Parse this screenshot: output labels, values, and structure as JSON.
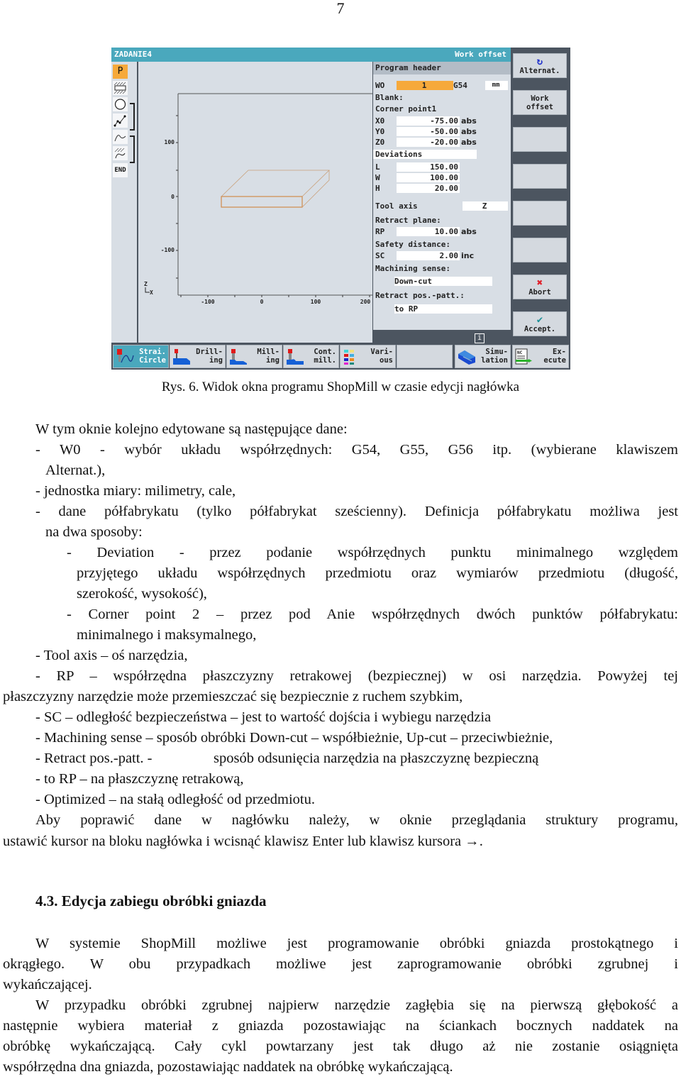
{
  "page_number": "7",
  "screen": {
    "title": "ZADANIE4",
    "mode": "Work offset",
    "left_strip": [
      "P",
      "blank-rect-icon",
      "circle-pocket-icon",
      "contour-points-icon",
      "contour-curve-icon",
      "contour-mill-icon",
      "END"
    ],
    "graph": {
      "y_ticks": [
        "100",
        "0",
        "-100"
      ],
      "x_ticks": [
        "-100",
        "0",
        "100",
        "200"
      ],
      "axis_z": "Z",
      "axis_x": "X"
    },
    "form": {
      "header": "Program header",
      "w0_label": "WO",
      "w0_value": "1",
      "w0_g": "G54",
      "unit": "mm",
      "blank_label": "Blank:",
      "corner_label": "Corner point1",
      "x0_label": "X0",
      "x0_value": "-75.00",
      "x0_unit": "abs",
      "y0_label": "Y0",
      "y0_value": "-50.00",
      "y0_unit": "abs",
      "z0_label": "Z0",
      "z0_value": "-20.00",
      "z0_unit": "abs",
      "deviations_label": "Deviations",
      "l_label": "L",
      "l_value": "150.00",
      "w_label": "W",
      "w_value": "100.00",
      "h_label": "H",
      "h_value": "20.00",
      "tool_axis_label": "Tool axis",
      "tool_axis_value": "Z",
      "retract_plane_label": "Retract plane:",
      "rp_label": "RP",
      "rp_value": "10.00",
      "rp_unit": "abs",
      "safety_label": "Safety distance:",
      "sc_label": "SC",
      "sc_value": "2.00",
      "sc_unit": "inc",
      "machining_label": "Machining sense:",
      "machining_value": "Down-cut",
      "retract_patt_label": "Retract pos.-patt.:",
      "retract_patt_value": "to RP"
    },
    "vertical_softkeys": [
      {
        "line1": "Alternat.",
        "line2": ""
      },
      {
        "line1": "Work",
        "line2": "offset"
      },
      {
        "line1": "",
        "line2": ""
      },
      {
        "line1": "",
        "line2": ""
      },
      {
        "line1": "",
        "line2": ""
      },
      {
        "line1": "",
        "line2": ""
      },
      {
        "line1": "Abort",
        "line2": ""
      },
      {
        "line1": "Accept.",
        "line2": ""
      }
    ],
    "horizontal_softkeys": [
      {
        "line1": "Strai.",
        "line2": "Circle"
      },
      {
        "line1": "Drill-",
        "line2": "ing"
      },
      {
        "line1": "Mill-",
        "line2": "ing"
      },
      {
        "line1": "Cont.",
        "line2": "mill."
      },
      {
        "line1": "Vari-",
        "line2": "ous"
      },
      {
        "line1": "",
        "line2": ""
      },
      {
        "line1": "Simu-",
        "line2": "lation"
      },
      {
        "line1": "Ex-",
        "line2": "ecute"
      }
    ],
    "info_glyph": "i"
  },
  "caption": "Rys. 6. Widok okna programu ShopMill w czasie edycji nagłówka",
  "body": {
    "intro": "W tym oknie kolejno edytowane są następujące dane:",
    "w0_line1": "- W0 - wybór układu współrzędnych: G54, G55, G56 itp. (wybierane klawiszem",
    "w0_line2": "Alternat.),",
    "unit_line": "- jednostka miary: milimetry, cale,",
    "blank_line1": "- dane półfabrykatu (tylko półfabrykat sześcienny). Definicja półfabrykatu możliwa jest",
    "blank_line2": "na dwa sposoby:",
    "dev_line1": "- Deviation - przez podanie współrzędnych punktu minimalnego względem",
    "dev_line2": "przyjętego układu współrzędnych przedmiotu oraz wymiarów przedmiotu (długość,",
    "dev_line3": "szerokość, wysokość),",
    "corner_line1": "- Corner point 2 – przez pod Anie współrzędnych dwóch punktów półfabrykatu:",
    "corner_line2": "minimalnego i maksymalnego,",
    "tool_line": "- Tool axis – oś narzędzia,",
    "rp_line1": "- RP – współrzędna płaszczyzny retrakowej (bezpiecznej) w osi narzędzia. Powyżej tej",
    "rp_line2": "płaszczyzny narzędzie może przemieszczać się bezpiecznie z ruchem szybkim,",
    "sc_line": "- SC – odległość bezpieczeństwa – jest to wartość dojścia i wybiegu narzędzia",
    "mach_line": "- Machining sense – sposób obróbki Down-cut – współbieżnie, Up-cut – przeciwbieżnie,",
    "retract_line_a": "- Retract pos.-patt. -",
    "retract_line_b": "sposób odsunięcia narzędzia na płaszczyznę bezpieczną",
    "torp_line": "- to RP – na płaszczyznę retrakową,",
    "opt_line": "- Optimized – na stałą odległość od przedmiotu.",
    "fix_line1": "Aby poprawić dane w nagłówku należy, w oknie przeglądania struktury programu,",
    "fix_line2": "ustawić kursor na bloku nagłówka i wcisnąć klawisz Enter lub klawisz kursora →."
  },
  "section": {
    "heading": "4.3. Edycja zabiegu obróbki gniazda",
    "p1_line1": "W systemie ShopMill możliwe jest programowanie obróbki gniazda prostokątnego i",
    "p1_line2": "okrągłego. W obu przypadkach możliwe jest zaprogramowanie obróbki zgrubnej i",
    "p1_line3": "wykańczającej.",
    "p2_line1": "W przypadku obróbki zgrubnej najpierw narzędzie zagłębia się na pierwszą głębokość a",
    "p2_line2": "następnie wybiera materiał z gniazda pozostawiając na ściankach bocznych naddatek na",
    "p2_line3": "obróbkę wykańczającą. Cały cykl powtarzany jest tak długo aż nie zostanie osiągnięta",
    "p2_line4": "współrzędna dna gniazda, pozostawiając naddatek na obróbkę wykańczającą."
  }
}
